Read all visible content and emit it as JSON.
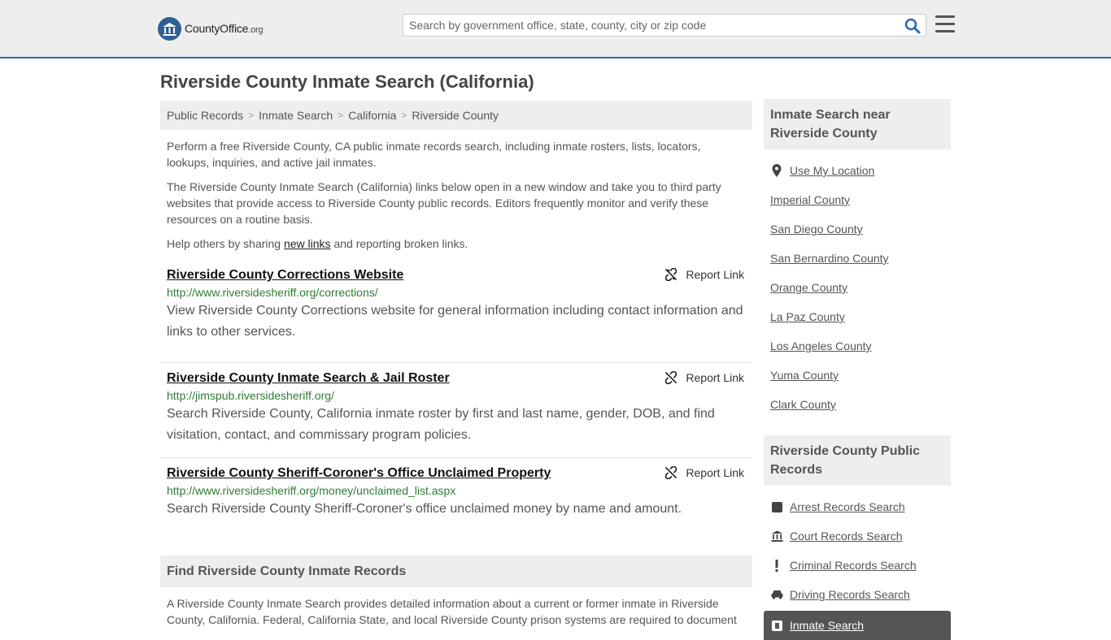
{
  "header": {
    "logo_name": "CountyOffice",
    "logo_tld": ".org",
    "search_placeholder": "Search by government office, state, county, city or zip code"
  },
  "page_title": "Riverside County Inmate Search (California)",
  "breadcrumb": [
    "Public Records",
    "Inmate Search",
    "California",
    "Riverside County"
  ],
  "intro": {
    "p1": "Perform a free Riverside County, CA public inmate records search, including inmate rosters, lists, locators, lookups, inquiries, and active jail inmates.",
    "p2": "The Riverside County Inmate Search (California) links below open in a new window and take you to third party websites that provide access to Riverside County public records. Editors frequently monitor and verify these resources on a routine basis.",
    "p3_before": "Help others by sharing ",
    "p3_link": "new links",
    "p3_after": " and reporting broken links."
  },
  "report_label": "Report Link",
  "results": [
    {
      "title": "Riverside County Corrections Website",
      "url": "http://www.riversidesheriff.org/corrections/",
      "desc": "View Riverside County Corrections website for general information including contact information and links to other services."
    },
    {
      "title": "Riverside County Inmate Search & Jail Roster",
      "url": "http://jimspub.riversidesheriff.org/",
      "desc": "Search Riverside County, California inmate roster by first and last name, gender, DOB, and find visitation, contact, and commissary program policies."
    },
    {
      "title": "Riverside County Sheriff-Coroner's Office Unclaimed Property",
      "url": "http://www.riversidesheriff.org/money/unclaimed_list.aspx",
      "desc": "Search Riverside County Sheriff-Coroner's office unclaimed money by name and amount."
    }
  ],
  "find_section": {
    "heading": "Find Riverside County Inmate Records",
    "text": "A Riverside County Inmate Search provides detailed information about a current or former inmate in Riverside County, California. Federal, California State, and local Riverside County prison systems are required to document"
  },
  "sidebar": {
    "nearby_heading": "Inmate Search near Riverside County",
    "use_location": "Use My Location",
    "nearby": [
      "Imperial County",
      "San Diego County",
      "San Bernardino County",
      "Orange County",
      "La Paz County",
      "Los Angeles County",
      "Yuma County",
      "Clark County"
    ],
    "records_heading": "Riverside County Public Records",
    "records": [
      {
        "label": "Arrest Records Search",
        "icon": "square-icon"
      },
      {
        "label": "Court Records Search",
        "icon": "courthouse-icon"
      },
      {
        "label": "Criminal Records Search",
        "icon": "exclamation-icon"
      },
      {
        "label": "Driving Records Search",
        "icon": "car-icon"
      }
    ],
    "active_item": "Inmate Search"
  },
  "colors": {
    "accent_line": "#2b6cb0",
    "url_green": "#2e7d32",
    "panel_gray": "#eeeeee"
  }
}
